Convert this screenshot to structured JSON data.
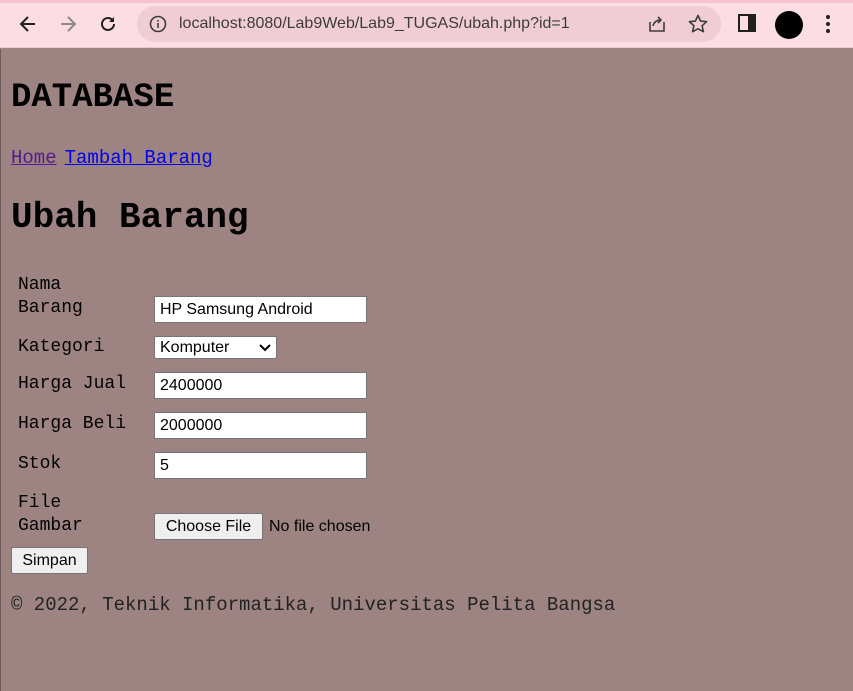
{
  "browser": {
    "url": "localhost:8080/Lab9Web/Lab9_TUGAS/ubah.php?id=1"
  },
  "site": {
    "title": "DATABASE"
  },
  "nav": {
    "home": "Home",
    "add": "Tambah Barang"
  },
  "page": {
    "title": "Ubah Barang"
  },
  "form": {
    "nama_label_line1": "Nama",
    "nama_label_line2": "Barang",
    "nama_value": "HP Samsung Android",
    "kategori_label": "Kategori",
    "kategori_value": "Komputer",
    "harga_jual_label": "Harga Jual",
    "harga_jual_value": "2400000",
    "harga_beli_label": "Harga Beli",
    "harga_beli_value": "2000000",
    "stok_label": "Stok",
    "stok_value": "5",
    "file_label_line1": "File",
    "file_label_line2": "Gambar",
    "file_button": "Choose File",
    "file_status": "No file chosen",
    "submit": "Simpan"
  },
  "footer": {
    "text": "© 2022, Teknik Informatika, Universitas Pelita Bangsa"
  }
}
